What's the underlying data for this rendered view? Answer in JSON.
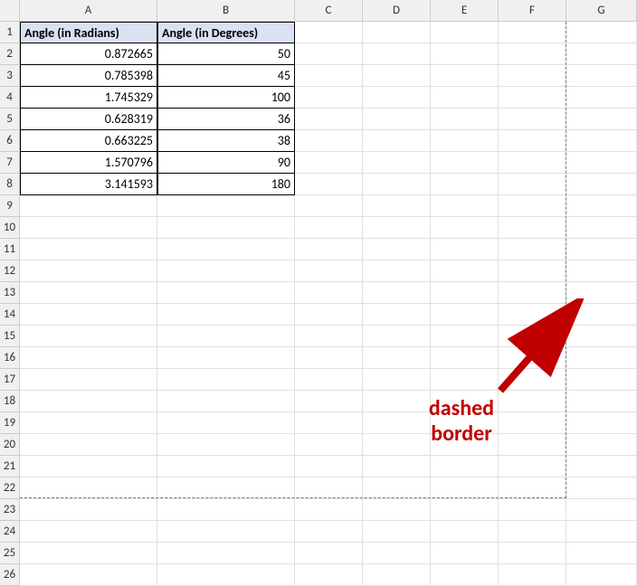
{
  "columns": [
    "A",
    "B",
    "C",
    "D",
    "E",
    "F",
    "G"
  ],
  "rowCount": 26,
  "headers": {
    "A": "Angle (in Radians)",
    "B": "Angle (in Degrees)"
  },
  "data": [
    {
      "rad": "0.872665",
      "deg": "50"
    },
    {
      "rad": "0.785398",
      "deg": "45"
    },
    {
      "rad": "1.745329",
      "deg": "100"
    },
    {
      "rad": "0.628319",
      "deg": "36"
    },
    {
      "rad": "0.663225",
      "deg": "38"
    },
    {
      "rad": "1.570796",
      "deg": "90"
    },
    {
      "rad": "3.141593",
      "deg": "180"
    }
  ],
  "annotation": {
    "line1": "dashed",
    "line2": "border"
  }
}
